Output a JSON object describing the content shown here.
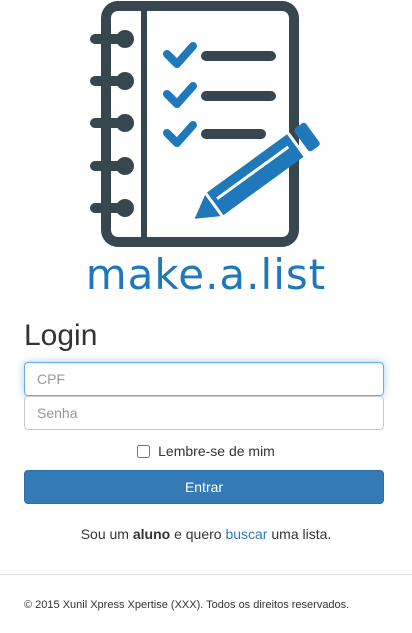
{
  "logo": {
    "text": "make.a.list",
    "icon": "notebook-checklist-pencil-icon",
    "colors": {
      "dark": "#37474f",
      "blue": "#1e78b9"
    }
  },
  "login": {
    "title": "Login",
    "cpf_placeholder": "CPF",
    "senha_placeholder": "Senha",
    "remember_label": "Lembre-se de mim",
    "remember_checked": false,
    "submit_label": "Entrar"
  },
  "student_line": {
    "before": "Sou um ",
    "bold": "aluno",
    "middle": " e quero ",
    "link": "buscar",
    "after": " uma lista."
  },
  "footer": {
    "text": "© 2015 Xunil Xpress Xpertise (XXX). Todos os direitos reservados."
  },
  "colors": {
    "primary": "#337ab7",
    "focus_border": "#66afe9",
    "text": "#333333"
  }
}
